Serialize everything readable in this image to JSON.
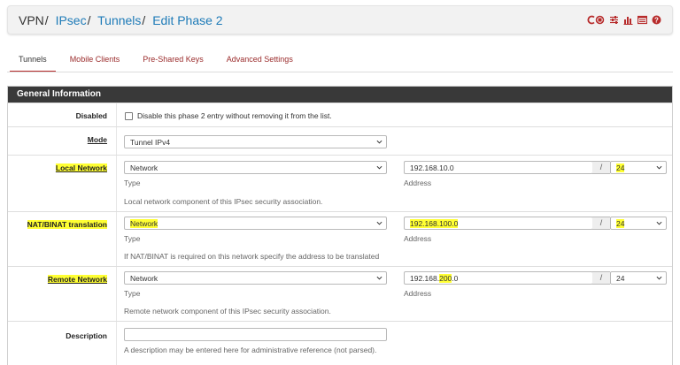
{
  "breadcrumb": {
    "items": [
      {
        "label": "VPN",
        "link": false
      },
      {
        "label": "IPsec",
        "link": true
      },
      {
        "label": "Tunnels",
        "link": true
      },
      {
        "label": "Edit Phase 2",
        "link": true
      }
    ],
    "separator": "/"
  },
  "toolbar_icons": [
    "restart-service-icon",
    "settings-sliders-icon",
    "bar-chart-icon",
    "log-list-icon",
    "help-icon"
  ],
  "tabs": [
    {
      "label": "Tunnels",
      "active": true
    },
    {
      "label": "Mobile Clients",
      "active": false
    },
    {
      "label": "Pre-Shared Keys",
      "active": false
    },
    {
      "label": "Advanced Settings",
      "active": false
    }
  ],
  "panel": {
    "title": "General Information",
    "disabled": {
      "label": "Disabled",
      "checkbox_text": "Disable this phase 2 entry without removing it from the list.",
      "checked": false
    },
    "mode": {
      "label": "Mode",
      "value": "Tunnel IPv4"
    },
    "local_network": {
      "label": "Local Network",
      "type_value": "Network",
      "type_caption": "Type",
      "address_value": "192.168.10.0",
      "address_caption": "Address",
      "mask_separator": "/",
      "mask_value": "24",
      "hint": "Local network component of this IPsec security association."
    },
    "nat_binat": {
      "label": "NAT/BINAT translation",
      "type_value": "Network",
      "type_caption": "Type",
      "address_value": "192.168.100.0",
      "address_caption": "Address",
      "mask_separator": "/",
      "mask_value": "24",
      "hint": "If NAT/BINAT is required on this network specify the address to be translated"
    },
    "remote_network": {
      "label": "Remote Network",
      "type_value": "Network",
      "type_caption": "Type",
      "address_prefix": "192.168.",
      "address_highlight": "200",
      "address_suffix": ".0",
      "address_caption": "Address",
      "mask_separator": "/",
      "mask_value": "24",
      "hint": "Remote network component of this IPsec security association."
    },
    "description": {
      "label": "Description",
      "value": "",
      "hint": "A description may be entered here for administrative reference (not parsed)."
    }
  },
  "colors": {
    "accent_red": "#b72b2b",
    "link_blue": "#1e7bb8",
    "panel_header": "#393939",
    "highlight": "#ffff33"
  }
}
